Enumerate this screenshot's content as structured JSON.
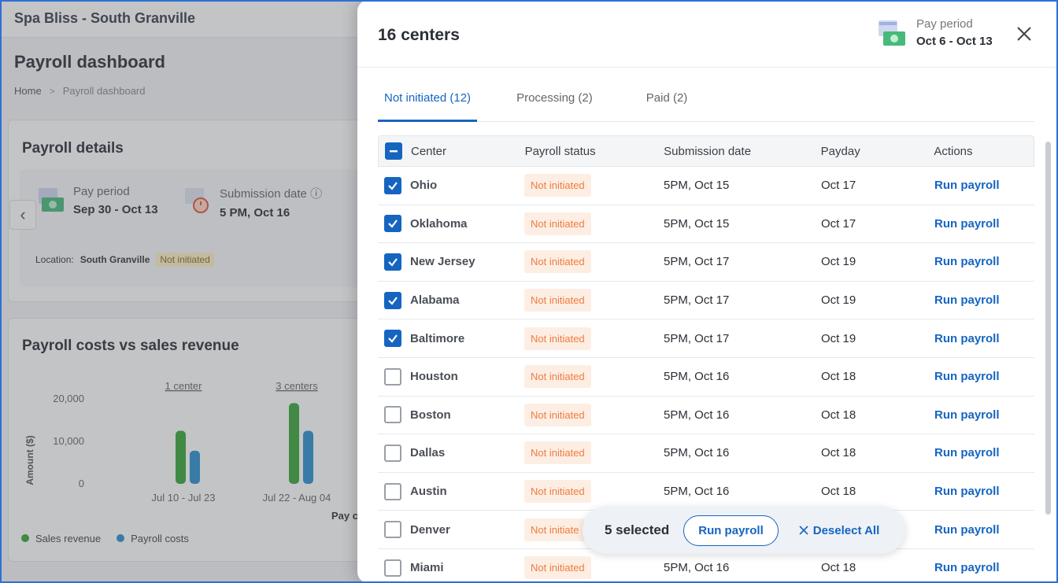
{
  "background": {
    "app_title": "Spa Bliss - South Granville",
    "page_title": "Payroll dashboard",
    "breadcrumb": [
      "Home",
      "Payroll dashboard"
    ],
    "payroll_details": {
      "title": "Payroll details",
      "pay_period_label": "Pay period",
      "pay_period_value": "Sep 30 - Oct 13",
      "submission_label": "Submission date",
      "submission_value": "5 PM, Oct 16",
      "location_label": "Location:",
      "location_value": "South Granville",
      "status": "Not initiated"
    },
    "costs_chart": {
      "title": "Payroll costs vs sales revenue",
      "ylabel": "Amount ($)",
      "xlabel_partial": "Pay c",
      "legend": [
        "Sales revenue",
        "Payroll costs"
      ]
    }
  },
  "chart_data": {
    "type": "bar",
    "title": "Payroll costs vs sales revenue",
    "ylabel": "Amount ($)",
    "y_ticks": [
      "20,000",
      "10,000",
      "0"
    ],
    "ylim": [
      0,
      20000
    ],
    "categories": [
      "Jul 10 - Jul 23",
      "Jul 22 - Aug 04"
    ],
    "group_labels": [
      "1 center",
      "3 centers"
    ],
    "series": [
      {
        "name": "Sales revenue",
        "values": [
          12500,
          19000
        ],
        "color": "#3aa53a"
      },
      {
        "name": "Payroll costs",
        "values": [
          7800,
          12500
        ],
        "color": "#2b8fcf"
      }
    ]
  },
  "drawer": {
    "title": "16 centers",
    "pay_period_label": "Pay period",
    "pay_period_value": "Oct 6 - Oct 13",
    "tabs": [
      "Not initiated (12)",
      "Processing (2)",
      "Paid (2)"
    ],
    "columns": [
      "Center",
      "Payroll status",
      "Submission date",
      "Payday",
      "Actions"
    ],
    "rows": [
      {
        "center": "Ohio",
        "status": "Not initiated",
        "submission": "5PM, Oct 15",
        "payday": "Oct 17",
        "action": "Run payroll",
        "checked": true
      },
      {
        "center": "Oklahoma",
        "status": "Not initiated",
        "submission": "5PM, Oct 15",
        "payday": "Oct 17",
        "action": "Run payroll",
        "checked": true
      },
      {
        "center": "New Jersey",
        "status": "Not initiated",
        "submission": "5PM, Oct 17",
        "payday": "Oct 19",
        "action": "Run payroll",
        "checked": true
      },
      {
        "center": "Alabama",
        "status": "Not initiated",
        "submission": "5PM, Oct 17",
        "payday": "Oct 19",
        "action": "Run payroll",
        "checked": true
      },
      {
        "center": "Baltimore",
        "status": "Not initiated",
        "submission": "5PM, Oct 17",
        "payday": "Oct 19",
        "action": "Run payroll",
        "checked": true
      },
      {
        "center": "Houston",
        "status": "Not initiated",
        "submission": "5PM, Oct 16",
        "payday": "Oct 18",
        "action": "Run payroll",
        "checked": false
      },
      {
        "center": "Boston",
        "status": "Not initiated",
        "submission": "5PM, Oct 16",
        "payday": "Oct 18",
        "action": "Run payroll",
        "checked": false
      },
      {
        "center": "Dallas",
        "status": "Not initiated",
        "submission": "5PM, Oct 16",
        "payday": "Oct 18",
        "action": "Run payroll",
        "checked": false
      },
      {
        "center": "Austin",
        "status": "Not initiated",
        "submission": "5PM, Oct 16",
        "payday": "Oct 18",
        "action": "Run payroll",
        "checked": false
      },
      {
        "center": "Denver",
        "status": "Not initiate",
        "submission": "",
        "payday": "",
        "action": "Run payroll",
        "checked": false
      },
      {
        "center": "Miami",
        "status": "Not initiated",
        "submission": "5PM, Oct 16",
        "payday": "Oct 18",
        "action": "Run payroll",
        "checked": false
      }
    ],
    "selection_bar": {
      "count": "5 selected",
      "run_label": "Run payroll",
      "deselect_label": "Deselect All"
    }
  }
}
